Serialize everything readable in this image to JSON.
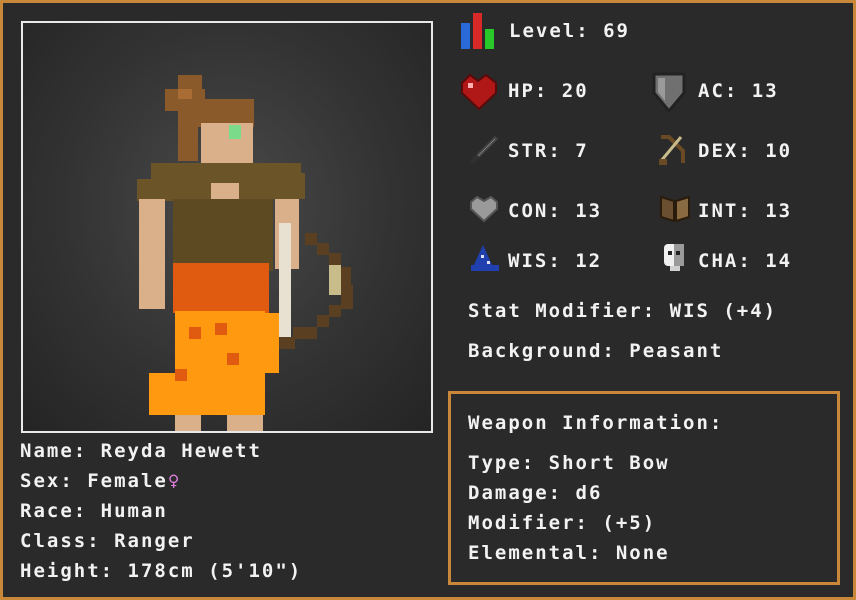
{
  "character": {
    "name_label": "Name:",
    "name": "Reyda Hewett",
    "sex_label": "Sex:",
    "sex": "Female",
    "race_label": "Race:",
    "race": "Human",
    "class_label": "Class:",
    "class": "Ranger",
    "height_label": "Height:",
    "height": "178cm (5'10\")"
  },
  "level": {
    "label": "Level:",
    "value": "69"
  },
  "stats": {
    "hp": {
      "label": "HP:",
      "value": "20",
      "icon": "heart-icon"
    },
    "ac": {
      "label": "AC:",
      "value": "13",
      "icon": "shield-icon"
    },
    "str": {
      "label": "STR:",
      "value": "7",
      "icon": "sword-icon"
    },
    "dex": {
      "label": "DEX:",
      "value": "10",
      "icon": "bow-icon"
    },
    "con": {
      "label": "CON:",
      "value": "13",
      "icon": "gray-heart-icon"
    },
    "int": {
      "label": "INT:",
      "value": "13",
      "icon": "book-icon"
    },
    "wis": {
      "label": "WIS:",
      "value": "12",
      "icon": "wizard-hat-icon"
    },
    "cha": {
      "label": "CHA:",
      "value": "14",
      "icon": "mask-icon"
    }
  },
  "stat_modifier": {
    "label": "Stat Modifier:",
    "value": "WIS (+4)"
  },
  "background": {
    "label": "Background:",
    "value": "Peasant"
  },
  "weapon": {
    "title": "Weapon Information:",
    "type_label": "Type:",
    "type": "Short Bow",
    "damage_label": "Damage:",
    "damage": "d6",
    "modifier_label": "Modifier:",
    "modifier": "(+5)",
    "elemental_label": "Elemental:",
    "elemental": "None"
  },
  "colors": {
    "border": "#c9873a",
    "background": "#2a2a2a",
    "text": "#f2f2f2",
    "female_symbol": "#e080e0"
  }
}
